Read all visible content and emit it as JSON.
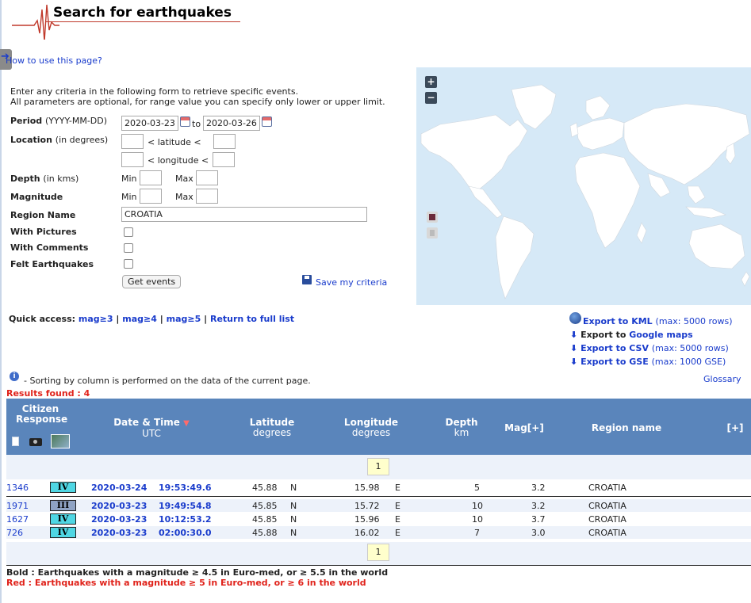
{
  "header": {
    "title": "Search for earthquakes",
    "howto_link": "How to use this page?"
  },
  "intro": {
    "line1": "Enter any criteria in the following form to retrieve specific events.",
    "line2": "All parameters are optional, for range value you can specify only lower or upper limit."
  },
  "form": {
    "period_label": "Period",
    "period_unit": "(YYYY-MM-DD)",
    "period_from": "2020-03-23",
    "period_to_label": "to",
    "period_to": "2020-03-26",
    "location_label": "Location",
    "location_unit": "(in degrees)",
    "latitude_label": "< latitude <",
    "longitude_label": "< longitude <",
    "depth_label": "Depth",
    "depth_unit": "(in kms)",
    "magnitude_label": "Magnitude",
    "min_label": "Min",
    "max_label": "Max",
    "region_label": "Region Name",
    "region_value": "CROATIA",
    "pictures_label": "With Pictures",
    "comments_label": "With Comments",
    "felt_label": "Felt Earthquakes",
    "get_events": "Get events",
    "save_criteria": "Save my criteria"
  },
  "map": {
    "zoom_in": "+",
    "zoom_out": "−"
  },
  "quick_access": {
    "label": "Quick access:",
    "items": [
      "mag≥3",
      "mag≥4",
      "mag≥5",
      "Return to full list"
    ],
    "separator": "|"
  },
  "exports": {
    "kml": "Export to KML",
    "kml_note": "(max: 5000 rows)",
    "google_prefix": "Export to",
    "google": "Google maps",
    "csv": "Export to CSV",
    "csv_note": "(max: 5000 rows)",
    "gse": "Export to GSE",
    "gse_note": "(max: 1000 GSE)",
    "glossary": "Glossary"
  },
  "sort_note": "- Sorting by column is performed on the data of the current page.",
  "results_found": "Results found : 4",
  "table": {
    "headers": {
      "citizen1": "Citizen",
      "citizen2": "Response",
      "datetime": "Date & Time",
      "datetime_sub": "UTC",
      "latitude": "Latitude",
      "latitude_sub": "degrees",
      "longitude": "Longitude",
      "longitude_sub": "degrees",
      "depth": "Depth",
      "depth_sub": "km",
      "mag": "Mag[+]",
      "region": "Region name",
      "more": "[+]"
    },
    "page": "1",
    "rows": [
      {
        "id": "1346",
        "intensity": "IV",
        "date": "2020-03-24",
        "time": "19:53:49.6",
        "lat": "45.88",
        "ns": "N",
        "lon": "15.98",
        "ew": "E",
        "depth": "5",
        "mag": "3.2",
        "region": "CROATIA"
      },
      {
        "id": "1971",
        "intensity": "III",
        "date": "2020-03-23",
        "time": "19:49:54.8",
        "lat": "45.85",
        "ns": "N",
        "lon": "15.72",
        "ew": "E",
        "depth": "10",
        "mag": "3.2",
        "region": "CROATIA"
      },
      {
        "id": "1627",
        "intensity": "IV",
        "date": "2020-03-23",
        "time": "10:12:53.2",
        "lat": "45.85",
        "ns": "N",
        "lon": "15.96",
        "ew": "E",
        "depth": "10",
        "mag": "3.7",
        "region": "CROATIA"
      },
      {
        "id": "726",
        "intensity": "IV",
        "date": "2020-03-23",
        "time": "02:00:30.0",
        "lat": "45.88",
        "ns": "N",
        "lon": "16.02",
        "ew": "E",
        "depth": "7",
        "mag": "3.0",
        "region": "CROATIA"
      }
    ]
  },
  "footer": {
    "bold_note": "Bold : Earthquakes with a magnitude ≥ 4.5 in Euro-med, or ≥ 5.5 in the world",
    "red_note": "Red : Earthquakes with a magnitude ≥ 5 in Euro-med, or ≥ 6 in the world"
  }
}
